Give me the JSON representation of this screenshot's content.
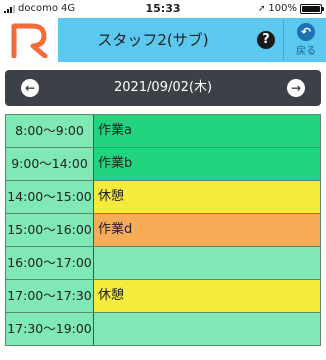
{
  "status_bar": {
    "carrier": "docomo",
    "network": "4G",
    "time": "15:33",
    "battery": "100%"
  },
  "header": {
    "logo_letter": "R",
    "title": "スタッフ2(サブ)",
    "help_icon": "?",
    "back_label": "戻る"
  },
  "date_nav": {
    "date": "2021/09/02(木)"
  },
  "schedule": [
    {
      "time": "8:00〜9:00",
      "task": "作業a",
      "color": "#22d47e"
    },
    {
      "time": "9:00〜14:00",
      "task": "作業b",
      "color": "#22d47e"
    },
    {
      "time": "14:00〜15:00",
      "task": "休憩",
      "color": "#f5eb3c"
    },
    {
      "time": "15:00〜16:00",
      "task": "作業d",
      "color": "#f7ac58"
    },
    {
      "time": "16:00〜17:00",
      "task": "",
      "color": "#7fe8b5"
    },
    {
      "time": "17:00〜17:30",
      "task": "休憩",
      "color": "#f5eb3c"
    },
    {
      "time": "17:30〜19:00",
      "task": "",
      "color": "#7fe8b5"
    }
  ],
  "colors": {
    "header_bg": "#5bc8f0",
    "time_cell_bg": "#7fe8b5",
    "date_nav_bg": "#3c4147",
    "logo_color": "#f26b3a"
  }
}
